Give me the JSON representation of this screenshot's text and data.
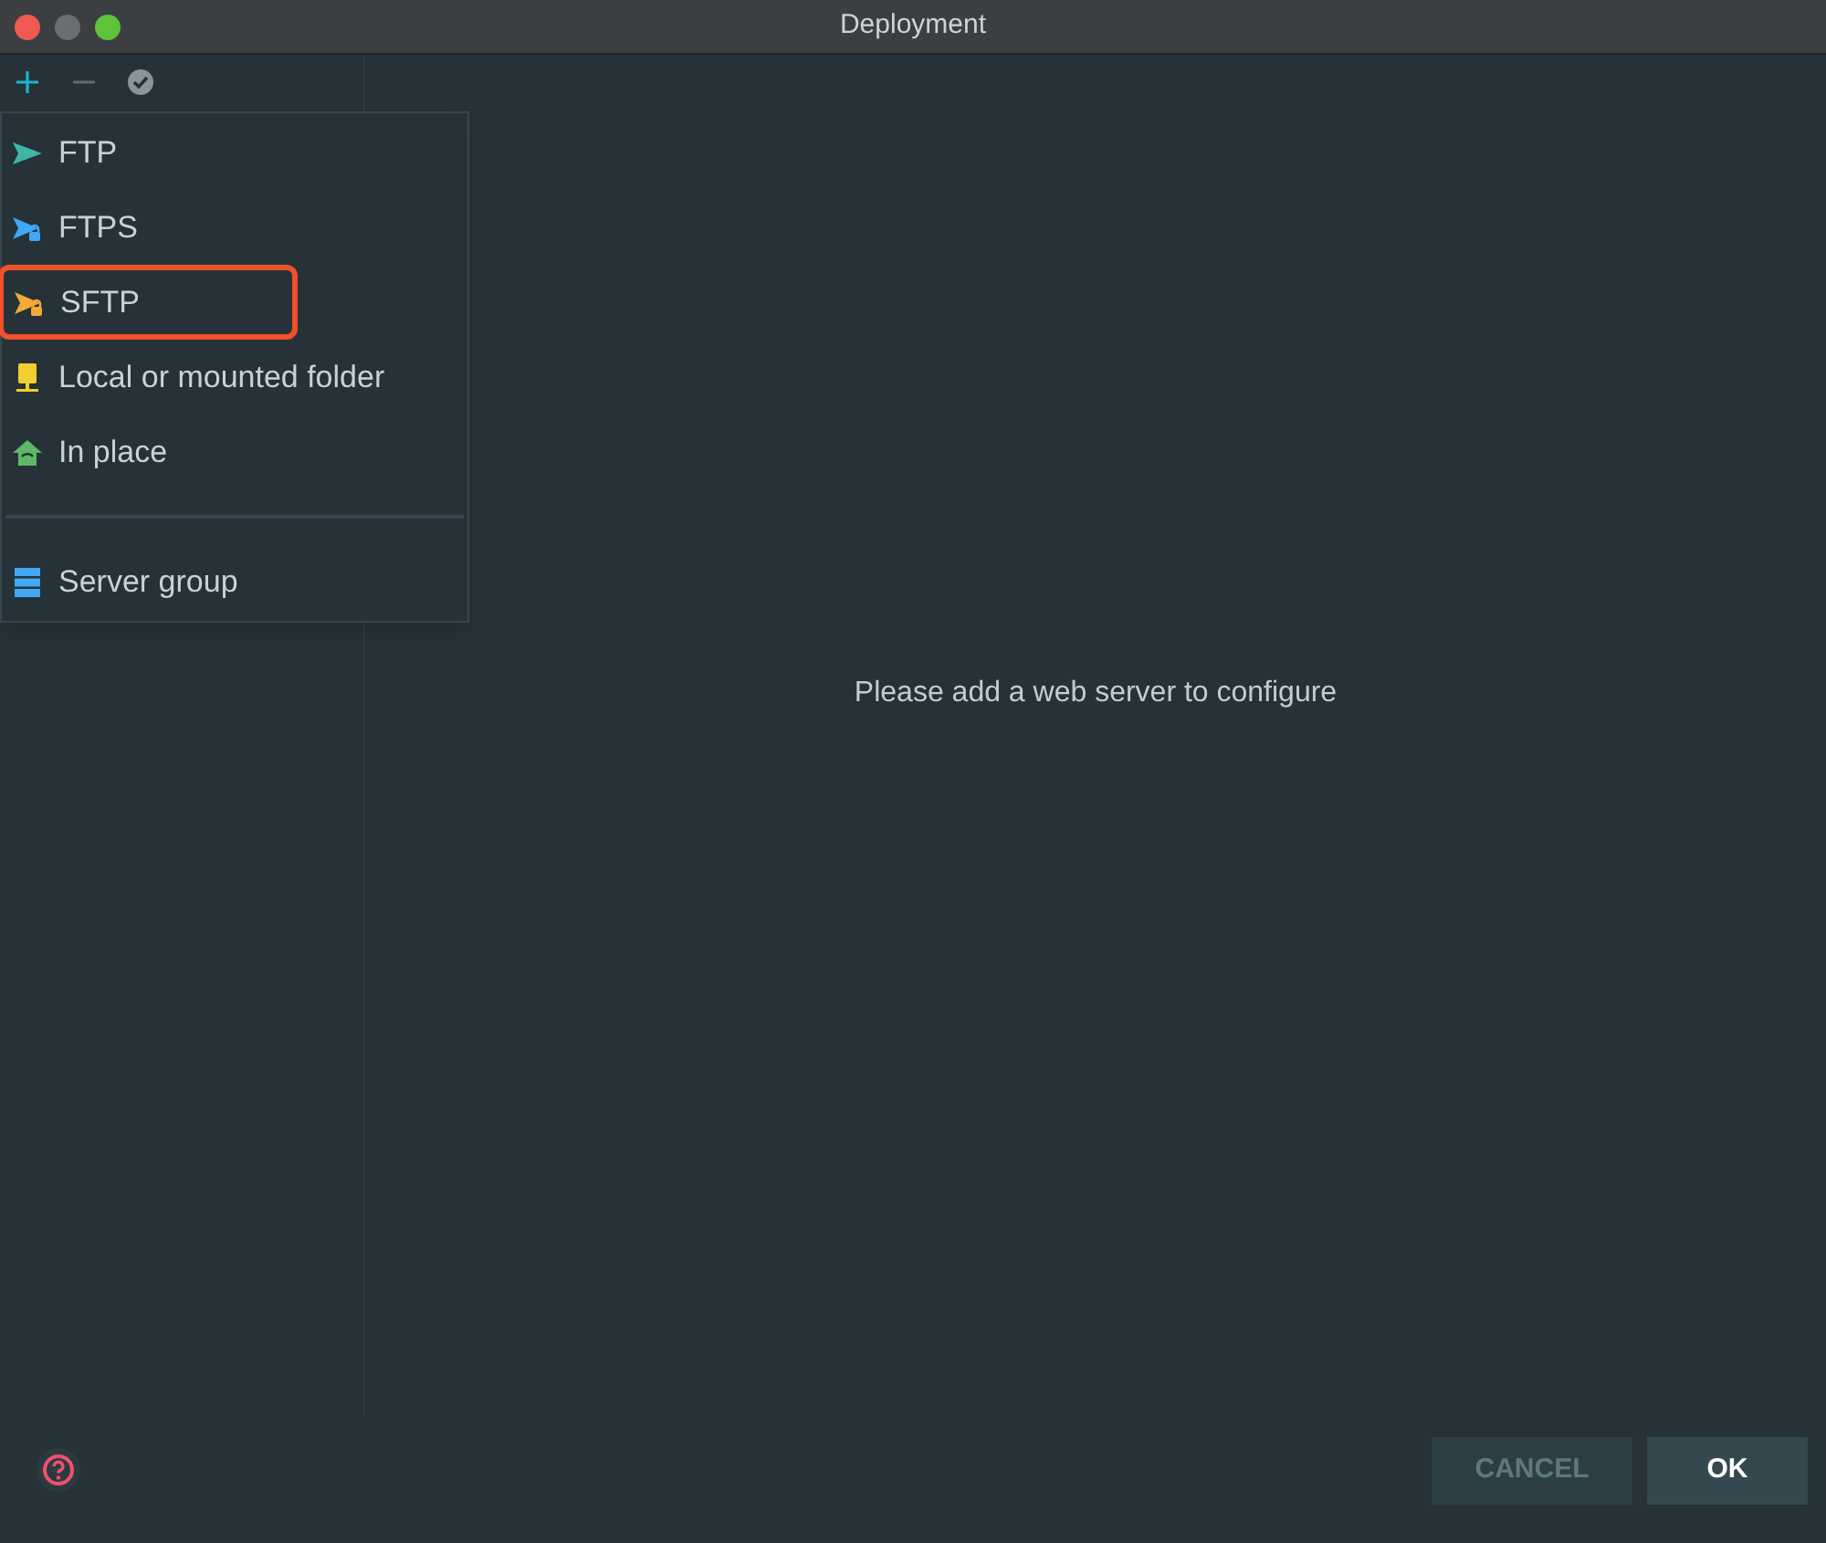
{
  "window": {
    "title": "Deployment"
  },
  "toolbar": [
    {
      "kind": "add",
      "disabled": false
    },
    {
      "kind": "remove",
      "disabled": true
    },
    {
      "kind": "default",
      "disabled": true
    }
  ],
  "menu": {
    "items": [
      {
        "kind": "ftp",
        "label": "FTP",
        "annotated": false
      },
      {
        "kind": "ftps",
        "label": "FTPS",
        "annotated": false
      },
      {
        "kind": "sftp",
        "label": "SFTP",
        "annotated": true
      },
      {
        "kind": "local",
        "label": "Local or mounted folder",
        "annotated": false
      },
      {
        "kind": "inplace",
        "label": "In place",
        "annotated": false
      },
      {
        "kind": "separator"
      },
      {
        "kind": "group",
        "label": "Server group",
        "annotated": false
      }
    ]
  },
  "empty_message": "Please add a web server to configure",
  "buttons": [
    {
      "label": "CANCEL",
      "disabled": true,
      "default": false
    },
    {
      "label": "OK",
      "disabled": false,
      "default": true
    }
  ]
}
